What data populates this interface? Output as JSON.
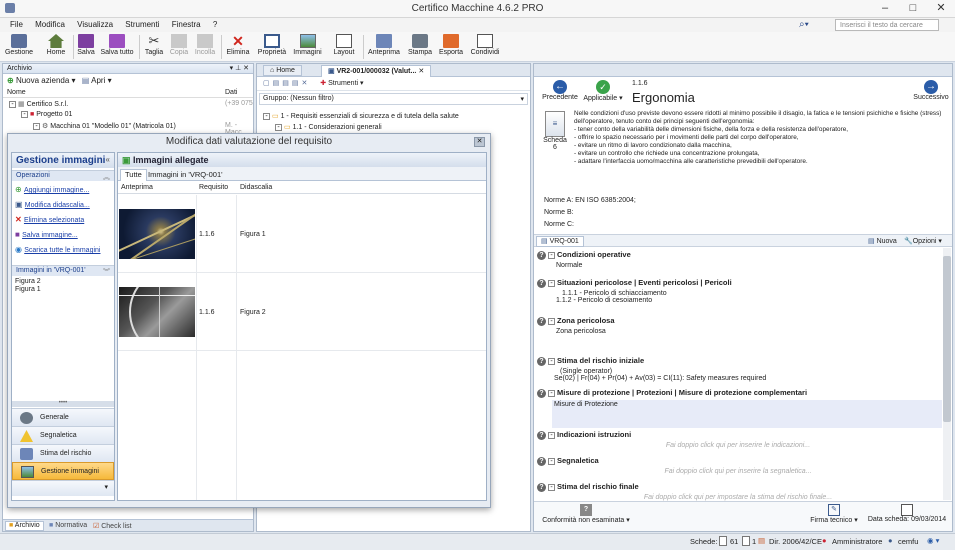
{
  "window": {
    "title": "Certifico Macchine 4.6.2 PRO"
  },
  "menu": [
    "File",
    "Modifica",
    "Visualizza",
    "Strumenti",
    "Finestra",
    "?"
  ],
  "search": {
    "placeholder": "Inserisci il testo da cercare"
  },
  "toolbar": [
    "Gestione",
    "Home",
    "Salva",
    "Salva tutto",
    "Taglia",
    "Copia",
    "Incolla",
    "Elimina",
    "Proprietà",
    "Immagini",
    "Layout",
    "Anteprima",
    "Stampa",
    "Esporta",
    "Condividi"
  ],
  "archive": {
    "title": "Archivio",
    "new_company": "Nuova azienda",
    "open": "Apri",
    "col_name": "Nome",
    "col_data": "Dati",
    "tree": [
      {
        "label": "Certifico S.r.l.",
        "value": "(+39 075"
      },
      {
        "label": "Progetto 01",
        "value": ""
      },
      {
        "label": "Macchina 01 \"Modello 01\" (Matricola 01)",
        "value": "M. - Macc"
      }
    ],
    "bottom_tabs": [
      "Archivio",
      "Normativa",
      "Check list"
    ]
  },
  "doc_tabs": {
    "home": "Home",
    "doc": "VR2-001/000032 (Valut...",
    "tools": "Strumenti",
    "group": "Gruppo: (Nessun filtro)",
    "tree": [
      "1 - Requisiti essenziali di sicurezza e di tutela della salute",
      "1.1 - Considerazioni generali"
    ]
  },
  "dialog": {
    "title": "Modifica dati valutazione del requisito",
    "sidebar_title": "Gestione immagini",
    "ops_title": "Operazioni",
    "ops": [
      "Aggiungi immagine...",
      "Modifica didascalia...",
      "Elimina selezionata",
      "Salva immagine...",
      "Scarica tutte le immagini"
    ],
    "images_in_title": "Immagini in 'VRQ-001'",
    "images_in": [
      "Figura 2",
      "Figura 1"
    ],
    "nav": [
      "Generale",
      "Segnaletica",
      "Stima del rischio",
      "Gestione immagini"
    ],
    "panel_title": "Immagini allegate",
    "tabs": [
      "Tutte",
      "Immagini in 'VRQ-001'"
    ],
    "columns": [
      "Anteprima",
      "Requisito",
      "Didascalia"
    ],
    "rows": [
      {
        "req": "1.1.6",
        "caption": "Figura 1"
      },
      {
        "req": "1.1.6",
        "caption": "Figura 2"
      }
    ]
  },
  "right": {
    "prev": "Precedente",
    "applicable": "Applicabile",
    "next": "Successivo",
    "code": "1.1.6",
    "title": "Ergonomia",
    "sheet": "Scheda",
    "sheet_no": "6",
    "body": [
      "Nelle condizioni d'uso previste devono essere ridotti al minimo possibile il disagio, la fatica e le tensioni psichiche e fisiche (stress) dell'operatore, tenuto conto dei principi seguenti dell'ergonomia:",
      "- tener conto della variabilità delle dimensioni fisiche, della forza e della resistenza dell'operatore,",
      "- offrire lo spazio necessario per i movimenti delle parti del corpo dell'operatore,",
      "- evitare un ritmo di lavoro condizionato dalla macchina,",
      "- evitare un controllo che richiede una concentrazione prolungata,",
      "- adattare l'interfaccia uomo/macchina alle caratteristiche prevedibili dell'operatore."
    ],
    "norms": [
      {
        "k": "Norme A:",
        "v": "EN ISO 6385:2004;"
      },
      {
        "k": "Norme B:",
        "v": ""
      },
      {
        "k": "Norme C:",
        "v": ""
      }
    ],
    "vrq_tab": "VRQ-001",
    "new": "Nuova",
    "options": "Opzioni",
    "sections": [
      {
        "title": "Condizioni operative",
        "lines": [
          "Normale"
        ],
        "hint": ""
      },
      {
        "title": "Situazioni pericolose | Eventi pericolosi | Pericoli",
        "lines": [
          "1.1.1 - Pericolo di schiacciamento",
          "1.1.2 - Pericolo di cesoiamento"
        ],
        "hint": ""
      },
      {
        "title": "Zona pericolosa",
        "lines": [
          "Zona pericolosa"
        ],
        "hint": ""
      },
      {
        "title": "Stima del rischio iniziale",
        "lines": [
          "(Single operator)",
          "Se(02) | Fr(04) + Pr(04) + Av(03) = CI(11): Safety measures required"
        ],
        "hint": ""
      },
      {
        "title": "Misure di protezione | Protezioni | Misure di protezione complementari",
        "lines": [
          "Misure di Protezione"
        ],
        "hint": ""
      },
      {
        "title": "Indicazioni istruzioni",
        "lines": [],
        "hint": "Fai doppio click qui per inserire le indicazioni..."
      },
      {
        "title": "Segnaletica",
        "lines": [],
        "hint": "Fai doppio click qui per inserire la segnaletica..."
      },
      {
        "title": "Stima del rischio finale",
        "lines": [],
        "hint": "Fai doppio click qui per impostare la stima del rischio finale..."
      }
    ],
    "footer": {
      "conformity": "Conformità non esaminata",
      "signature": "Firma tecnico",
      "date": "Data scheda: 09/03/2014"
    }
  },
  "status": {
    "sheets": "Schede:",
    "n1": "61",
    "n2": "1",
    "dir": "Dir. 2006/42/CE",
    "user": "Amministratore",
    "company": "cemfu"
  }
}
